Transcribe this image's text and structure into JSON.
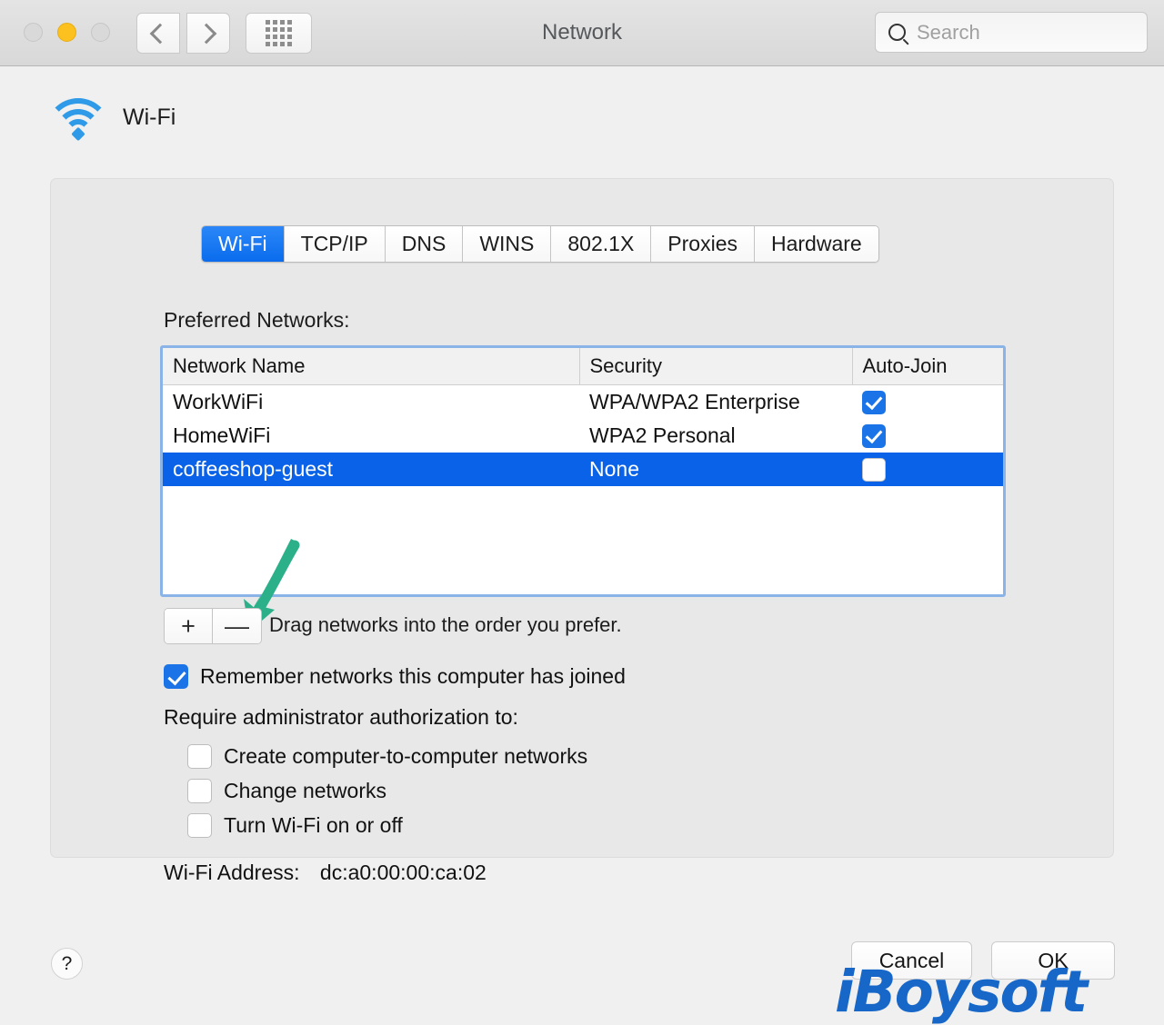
{
  "window": {
    "title": "Network",
    "traffic_lights": [
      "close",
      "minimize",
      "zoom"
    ],
    "back_icon": "chevron-left-icon",
    "forward_icon": "chevron-right-icon",
    "grid_icon": "show-all-grid-icon"
  },
  "search": {
    "placeholder": "Search",
    "value": "",
    "icon": "search-icon"
  },
  "service": {
    "name": "Wi-Fi",
    "icon": "wifi-icon"
  },
  "tabs": [
    {
      "label": "Wi-Fi",
      "active": true
    },
    {
      "label": "TCP/IP",
      "active": false
    },
    {
      "label": "DNS",
      "active": false
    },
    {
      "label": "WINS",
      "active": false
    },
    {
      "label": "802.1X",
      "active": false
    },
    {
      "label": "Proxies",
      "active": false
    },
    {
      "label": "Hardware",
      "active": false
    }
  ],
  "preferred": {
    "label": "Preferred Networks:",
    "columns": [
      "Network Name",
      "Security",
      "Auto-Join"
    ],
    "rows": [
      {
        "name": "WorkWiFi",
        "security": "WPA/WPA2 Enterprise",
        "auto_join": true,
        "selected": false
      },
      {
        "name": "HomeWiFi",
        "security": "WPA2 Personal",
        "auto_join": true,
        "selected": false
      },
      {
        "name": "coffeeshop-guest",
        "security": "None",
        "auto_join": false,
        "selected": true
      }
    ]
  },
  "table_controls": {
    "add_label": "+",
    "remove_label": "—",
    "hint": "Drag networks into the order you prefer."
  },
  "annotation": {
    "arrow_color": "#2bb089",
    "points_to": "remove-network-button"
  },
  "options": {
    "remember": {
      "label": "Remember networks this computer has joined",
      "checked": true
    },
    "require_label": "Require administrator authorization to:",
    "require_items": [
      {
        "label": "Create computer-to-computer networks",
        "checked": false
      },
      {
        "label": "Change networks",
        "checked": false
      },
      {
        "label": "Turn Wi-Fi on or off",
        "checked": false
      }
    ]
  },
  "wifi_address": {
    "label": "Wi-Fi Address:",
    "value": "dc:a0:00:00:ca:02"
  },
  "footer": {
    "help_label": "?",
    "cancel_label": "Cancel",
    "ok_label": "OK"
  },
  "watermark": {
    "text": "iBoysoft",
    "color": "#1767c8"
  },
  "colors": {
    "accent": "#0a62e8",
    "tab_active": "#1a7af0",
    "checkbox": "#1a74e8",
    "focus_ring": "#8ab3e8"
  }
}
